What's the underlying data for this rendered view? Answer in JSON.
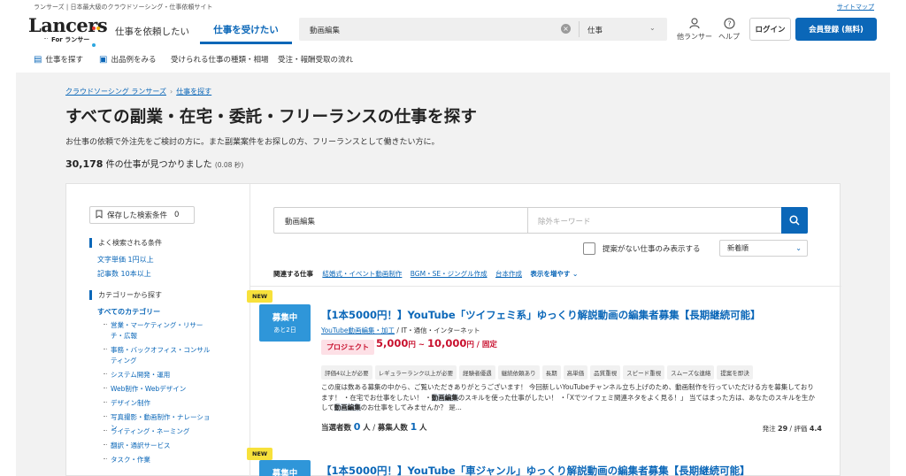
{
  "topline": {
    "tagline": "ランサーズ | 日本最大級のクラウドソーシング・仕事依頼サイト",
    "sitemap": "サイトマップ"
  },
  "logo": {
    "word": "Lancers",
    "sub": "For ランサー"
  },
  "header": {
    "tab_request": "仕事を依頼したい",
    "tab_receive": "仕事を受けたい",
    "search_query": "動画編集",
    "search_category": "仕事",
    "icon_other": "他ランサー",
    "icon_help": "ヘルプ",
    "login": "ログイン",
    "register": "会員登録 (無料)"
  },
  "subnav": {
    "find": "仕事を探す",
    "samples": "出品例をみる",
    "types": "受けられる仕事の種類・相場",
    "flow": "受注・報酬受取の流れ"
  },
  "breadcrumb": {
    "home": "クラウドソーシング ランサーズ",
    "current": "仕事を探す"
  },
  "page": {
    "title": "すべての副業・在宅・委託・フリーランスの仕事を探す",
    "desc": "お仕事の依頼で外注先をご検討の方に。また副業案件をお探しの方、フリーランスとして働きたい方に。",
    "count_num": "30,178",
    "count_text": " 件の仕事が見つかりました ",
    "count_time": "(0.08 秒)"
  },
  "sidebar": {
    "saved_label": "保存した検索条件",
    "saved_count": "0",
    "frequent_head": "よく検索される条件",
    "frequent": [
      "文字単価 1円以上",
      "記事数 10本以上"
    ],
    "category_head": "カテゴリーから探す",
    "all_categories": "すべてのカテゴリー",
    "categories": [
      "営業・マーケティング・リサーチ・広報",
      "事務・バックオフィス・コンサルティング",
      "システム開発・運用",
      "Web制作・Webデザイン",
      "デザイン制作",
      "写真撮影・動画制作・ナレーション",
      "ライティング・ネーミング",
      "翻訳・通訳サービス",
      "タスク・作業"
    ]
  },
  "main": {
    "keyword": "動画編集",
    "exclude_placeholder": "除外キーワード",
    "only_no_proposal": "提案がない仕事のみ表示する",
    "sort": "新着順",
    "related_label": "関連する仕事",
    "related": [
      "結婚式・イベント動画制作",
      "BGM・SE・ジングル作成",
      "台本作成"
    ],
    "related_more": "表示を増やす"
  },
  "jobs": [
    {
      "badge": "NEW",
      "status": "募集中",
      "remain": "あと2日",
      "title": "【1本5000円！】YouTube「ツイフェミ系」ゆっくり解説動画の編集者募集【長期継続可能】",
      "cat_link": "YouTube動画編集・加工",
      "cat_rest": " / IT・通信・インターネット",
      "type": "プロジェクト",
      "price_low": "5,000",
      "price_unit": "円",
      "price_sep": " ~ ",
      "price_high": "10,000",
      "price_suffix": "円 / 固定",
      "tags": [
        "評価4以上が必要",
        "レギュラーランク以上が必要",
        "経験者優遇",
        "継続依頼あり",
        "長期",
        "高単価",
        "品質重視",
        "スピード重視",
        "スムーズな連絡",
        "提案を即決"
      ],
      "desc_a": "この度は数ある募集の中から、ご覧いただきありがとうございます！ 今回新しいYouTubeチャンネル立ち上げのため、動画制作を行っていただける方を募集しております！ ・在宅でお仕事をしたい！ ・",
      "desc_m1": "動画編集",
      "desc_b": "のスキルを使った仕事がしたい！ ・「Xでツイフェミ関連ネタをよく見る！」 当てはまった方は、あなたのスキルを生かして",
      "desc_m2": "動画編集",
      "desc_c": "のお仕事をしてみませんか？ 是...",
      "f_label1": "当選者数",
      "f_num1": "0",
      "f_unit1": "人",
      "f_sep": " / ",
      "f_label2": "募集人数",
      "f_num2": "1",
      "f_unit2": "人",
      "rate_label1": "発注",
      "rate_val1": "29",
      "rate_sep": " / ",
      "rate_label2": "評価",
      "rate_val2": "4.4"
    },
    {
      "badge": "NEW",
      "status": "募集中",
      "title": "【1本5000円！】YouTube「車ジャンル」ゆっくり解説動画の編集者募集【長期継続可能】"
    }
  ]
}
